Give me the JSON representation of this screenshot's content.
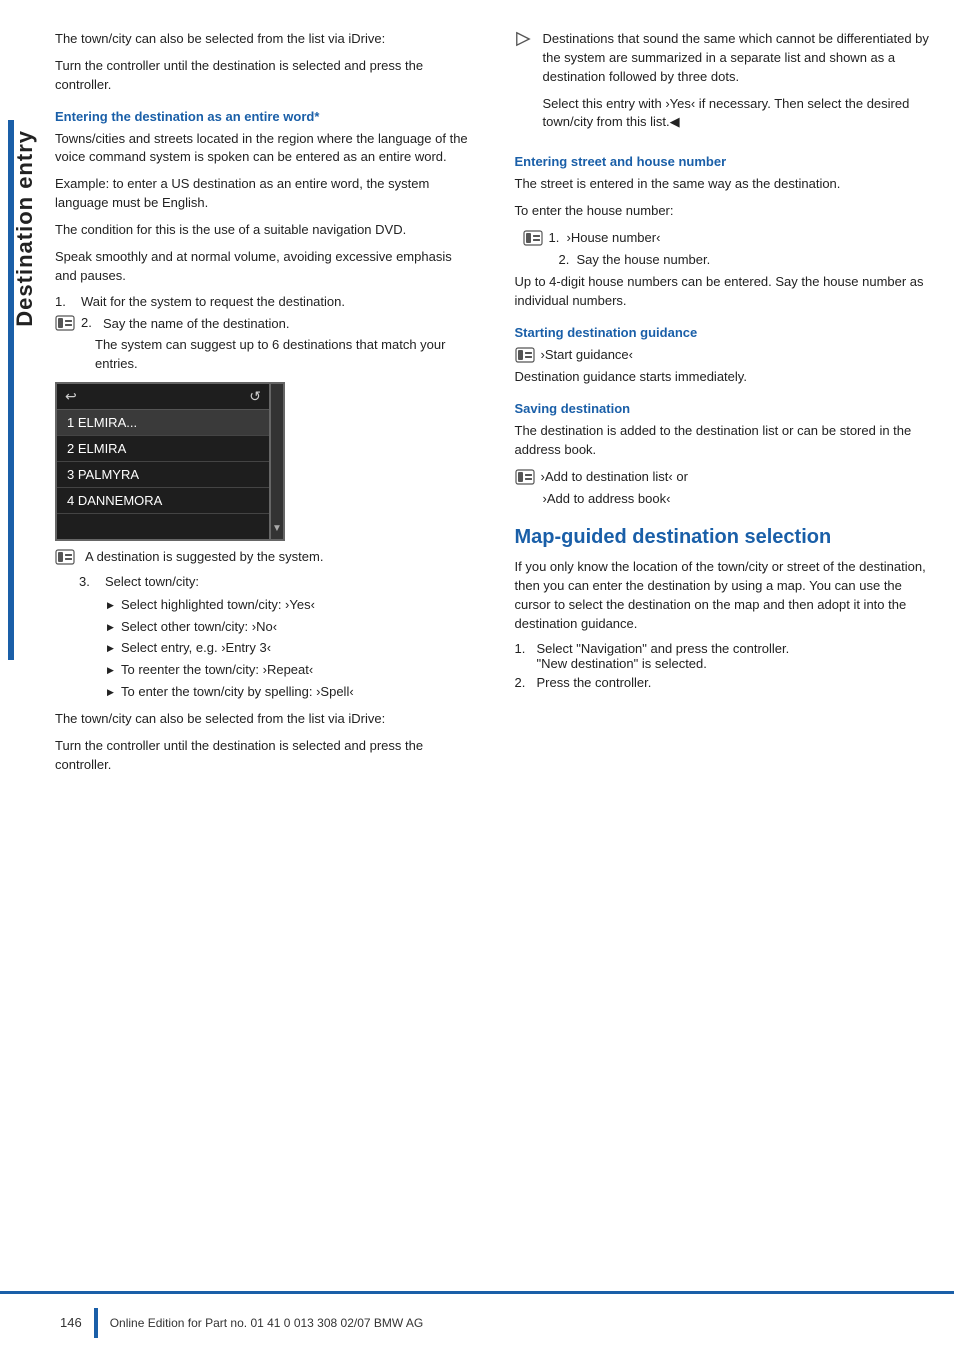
{
  "sidebar": {
    "text": "Destination entry",
    "accent_color": "#1a5fa8"
  },
  "left_col": {
    "intro_p1": "The town/city can also be selected from the list via iDrive:",
    "intro_p2": "Turn the controller until the destination is selected and press the controller.",
    "section1": {
      "heading": "Entering the destination as an entire word*",
      "p1": "Towns/cities and streets located in the region where the language of the voice command system is spoken can be entered as an entire word.",
      "p2": "Example: to enter a US destination as an entire word, the system language must be English.",
      "p3": "The condition for this is the use of a suitable navigation DVD.",
      "p4": "Speak smoothly and at normal volume, avoiding excessive emphasis and pauses.",
      "step1": "Wait for the system to request the destination.",
      "step2": "Say the name of the destination.",
      "step2_note": "The system can suggest up to 6 destinations that match your entries.",
      "screen_items": [
        "1 ELMIRA...",
        "2 ELMIRA",
        "3 PALMYRA",
        "4 DANNEMORA"
      ],
      "screen_note": "A destination is suggested by the system.",
      "step3": "Select town/city:",
      "substeps": [
        "Select highlighted town/city: ›Yes‹",
        "Select other town/city: ›No‹",
        "Select entry, e.g. ›Entry 3‹",
        "To reenter the town/city: ›Repeat‹",
        "To enter the town/city by spelling: ›Spell‹"
      ],
      "outro_p1": "The town/city can also be selected from the list via iDrive:",
      "outro_p2": "Turn the controller until the destination is selected and press the controller."
    }
  },
  "right_col": {
    "note_p1": "Destinations that sound the same which cannot be differentiated by the system are summarized in a separate list and shown as a destination followed by three dots.",
    "note_p2": "Select this entry with ›Yes‹ if necessary. Then select the desired town/city from this list.◀",
    "section2": {
      "heading": "Entering street and house number",
      "p1": "The street is entered in the same way as the destination.",
      "p2": "To enter the house number:",
      "step1": "›House number‹",
      "step2": "Say the house number.",
      "note": "Up to 4-digit house numbers can be entered. Say the house number as individual numbers."
    },
    "section3": {
      "heading": "Starting destination guidance",
      "cmd": "›Start guidance‹",
      "note": "Destination guidance starts immediately."
    },
    "section4": {
      "heading": "Saving destination",
      "p1": "The destination is added to the destination list or can be stored in the address book.",
      "cmd1": "›Add to destination list‹ or",
      "cmd2": "›Add to address book‹"
    },
    "section5": {
      "heading": "Map-guided destination selection",
      "p1": "If you only know the location of the town/city or street of the destination, then you can enter the destination by using a map. You can use the cursor to select the destination on the map and then adopt it into the destination guidance.",
      "step1": "Select \"Navigation\" and press the controller.",
      "step1_note": "\"New destination\" is selected.",
      "step2": "Press the controller."
    }
  },
  "footer": {
    "page": "146",
    "text": "Online Edition for Part no. 01 41 0 013 308 02/07 BMW AG"
  }
}
